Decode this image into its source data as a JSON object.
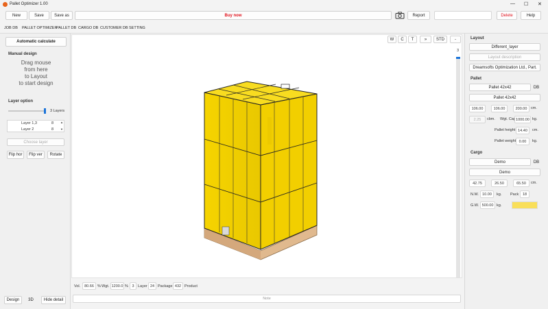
{
  "window": {
    "title": "Pallet Optimizer 1.00",
    "controls": [
      "—",
      "☐",
      "✕"
    ]
  },
  "toolbar": {
    "new": "New",
    "save": "Save",
    "save_as": "Save as",
    "buy_now": "Buy now",
    "report": "Report",
    "search_value": "",
    "delete": "Delete",
    "help": "Help"
  },
  "menu": [
    "JOB DB",
    "PALLET OPTIMIZER",
    "PALLET DB",
    "CARGO DB",
    "CUSTOMER DB",
    "SETTING"
  ],
  "left": {
    "auto_calc": "Automatic calculate",
    "manual_design": "Manual design",
    "drag_lines": [
      "Drag mouse",
      "from here",
      "to Layout",
      "to start design"
    ],
    "layer_option": "Layer option",
    "layers_count": "3 Layers",
    "slider_fraction": 1.0,
    "layers": [
      {
        "name": "Layer 1,3",
        "value": "8"
      },
      {
        "name": "Layer 2",
        "value": "8"
      }
    ],
    "choose_layer": "Choose layer",
    "flip_hor": "Flip hor",
    "flip_ver": "Flip ver",
    "rotate": "Rotate",
    "design": "Design",
    "view_3d": "3D",
    "hide_detail": "Hide detail"
  },
  "view": {
    "buttons": [
      "W",
      "C",
      "T",
      "»",
      "STD",
      "-"
    ],
    "layer_index": "3",
    "box_color": "#f6d400",
    "pallet_color": "#e0b98e"
  },
  "bottom": {
    "vol_label": "Vol.",
    "vol_value": "80.66",
    "pct1": "%",
    "wgt_label": "Wgt.",
    "wgt_value": "1200.0",
    "pct2": "%",
    "layer_value": "3",
    "layer_label": "Layer",
    "package_value": "24",
    "package_label": "Package",
    "product_value": "432",
    "product_label": "Product",
    "note": "Note"
  },
  "right": {
    "layout_title": "Layout",
    "different_layer": "Different_layer",
    "layout_description": "Layout description",
    "company": "Dreamsofts Optimization Ltd., Part.",
    "pallet_title": "Pallet",
    "pallet_select": "Pallet 42x42",
    "db1": "DB",
    "pallet_name": "Pallet 42x42",
    "dim1": "106.00",
    "dim2": "106.00",
    "dim3": "200.00",
    "cm1": "cm.",
    "cbm_value": "2.25",
    "cbm_label": "cbm.",
    "wgt_cap_label": "Wgt. Cap.",
    "wgt_cap_value": "1000.00",
    "kg1": "kg.",
    "pallet_height_label": "Pallet height",
    "pallet_height_value": "14.40",
    "cm2": "cm.",
    "pallet_weight_label": "Pallet weight",
    "pallet_weight_value": "0.00",
    "kg2": "kg.",
    "cargo_title": "Cargo",
    "cargo_select": "Demo",
    "db2": "DB",
    "cargo_name": "Demo",
    "cdim1": "42.75",
    "cdim2": "26.50",
    "cdim3": "65.50",
    "cm3": "cm.",
    "nw_label": "N.W.",
    "nw_value": "10.00",
    "kg3": "kg.",
    "pack_label": "Pack",
    "pack_value": "18",
    "gw_label": "G.W.",
    "gw_value": "500.00",
    "kg4": "kg.",
    "swatch_color": "#f9df5a"
  }
}
